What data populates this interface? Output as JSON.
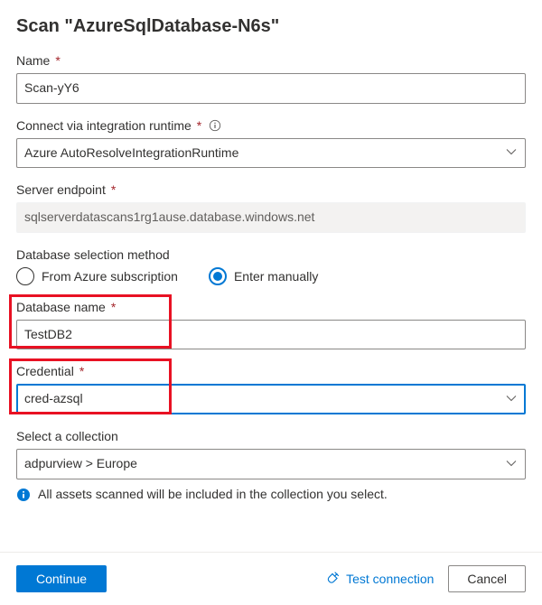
{
  "title": "Scan \"AzureSqlDatabase-N6s\"",
  "fields": {
    "name": {
      "label": "Name",
      "value": "Scan-yY6"
    },
    "runtime": {
      "label": "Connect via integration runtime",
      "value": "Azure AutoResolveIntegrationRuntime"
    },
    "endpoint": {
      "label": "Server endpoint",
      "value": "sqlserverdatascans1rg1ause.database.windows.net"
    },
    "db_select": {
      "label": "Database selection method",
      "options": {
        "subscription": "From Azure subscription",
        "manual": "Enter manually"
      },
      "selected": "manual"
    },
    "db_name": {
      "label": "Database name",
      "value": "TestDB2"
    },
    "credential": {
      "label": "Credential",
      "value": "cred-azsql"
    },
    "collection": {
      "label": "Select a collection",
      "value": "adpurview > Europe",
      "hint": "All assets scanned will be included in the collection you select."
    }
  },
  "footer": {
    "continue": "Continue",
    "test": "Test connection",
    "cancel": "Cancel"
  }
}
